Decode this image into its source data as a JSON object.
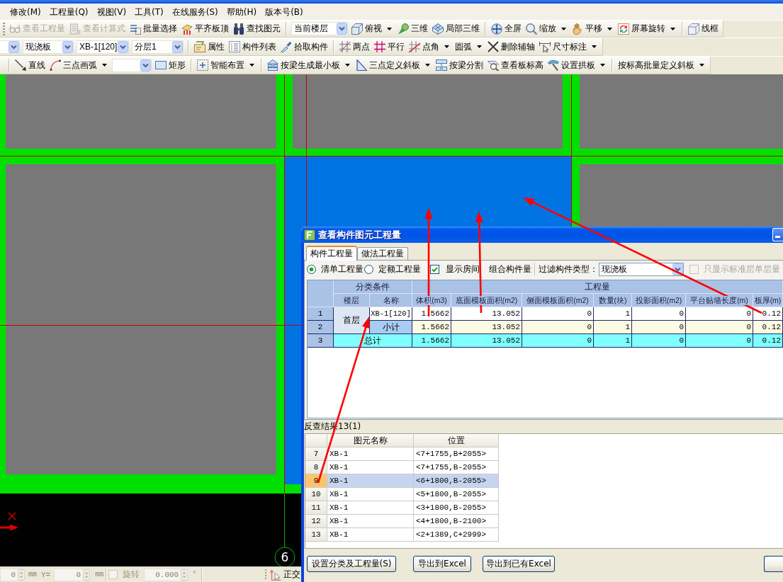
{
  "menu": [
    "修改(M)",
    "工程量(Q)",
    "视图(V)",
    "工具(T)",
    "在线服务(S)",
    "帮助(H)",
    "版本号(B)"
  ],
  "toolbars": [
    [
      [
        {
          "kind": "button",
          "label": "查看工程量",
          "dropdown": false,
          "disabled": true
        },
        {
          "kind": "button",
          "label": "查看计算式",
          "dropdown": false,
          "disabled": true
        },
        {
          "kind": "button",
          "label": "批量选择",
          "dropdown": false,
          "disabled": false
        },
        {
          "kind": "button",
          "label": "平齐板顶",
          "dropdown": false,
          "disabled": false
        },
        {
          "kind": "button",
          "label": "查找图元",
          "dropdown": false,
          "disabled": false
        }
      ],
      [
        {
          "kind": "combo",
          "value": "当前楼层"
        },
        {
          "kind": "button",
          "label": "俯视",
          "dropdown": true,
          "disabled": false
        },
        {
          "kind": "button",
          "label": "三维",
          "dropdown": false,
          "disabled": false
        },
        {
          "kind": "button",
          "label": "局部三维",
          "dropdown": false,
          "disabled": false
        }
      ],
      [
        {
          "kind": "button",
          "label": "全屏",
          "dropdown": false,
          "disabled": false
        },
        {
          "kind": "button",
          "label": "缩放",
          "dropdown": true,
          "disabled": false
        },
        {
          "kind": "button",
          "label": "平移",
          "dropdown": true,
          "disabled": false
        },
        {
          "kind": "button",
          "label": "屏幕旋转",
          "dropdown": true,
          "disabled": false
        }
      ],
      [
        {
          "kind": "button",
          "label": "线框",
          "dropdown": false,
          "disabled": false
        }
      ]
    ],
    [
      [
        {
          "kind": "combo"
        },
        {
          "kind": "combo",
          "value": "现浇板"
        },
        {
          "kind": "combo",
          "value": "XB-1[120]"
        },
        {
          "kind": "combo",
          "value": "分层1"
        }
      ],
      [
        {
          "kind": "button",
          "label": "属性",
          "dropdown": false,
          "disabled": false
        },
        {
          "kind": "button",
          "label": "构件列表",
          "dropdown": false,
          "disabled": false
        },
        {
          "kind": "button",
          "label": "拾取构件",
          "dropdown": false,
          "disabled": false
        }
      ],
      [
        {
          "kind": "button",
          "label": "两点",
          "dropdown": false,
          "disabled": false
        },
        {
          "kind": "button",
          "label": "平行",
          "dropdown": false,
          "disabled": false
        },
        {
          "kind": "button",
          "label": "点角",
          "dropdown": true,
          "disabled": false
        },
        {
          "kind": "button",
          "label": "圆弧",
          "dropdown": true,
          "disabled": false
        },
        {
          "kind": "button",
          "label": "删除辅轴",
          "dropdown": false,
          "disabled": false
        },
        {
          "kind": "button",
          "label": "尺寸标注",
          "dropdown": true,
          "disabled": false
        }
      ]
    ],
    [
      [
        {
          "kind": "button",
          "label": "直线",
          "dropdown": false,
          "disabled": false
        },
        {
          "kind": "button",
          "label": "三点画弧",
          "dropdown": true,
          "disabled": false
        },
        {
          "kind": "combo"
        },
        {
          "kind": "button",
          "label": "矩形",
          "dropdown": false,
          "disabled": false
        }
      ],
      [
        {
          "kind": "button",
          "label": "智能布置",
          "dropdown": true,
          "disabled": false
        }
      ],
      [
        {
          "kind": "button",
          "label": "按梁生成最小板",
          "dropdown": true,
          "disabled": false
        },
        {
          "kind": "button",
          "label": "三点定义斜板",
          "dropdown": true,
          "disabled": false
        },
        {
          "kind": "button",
          "label": "按梁分割",
          "dropdown": false,
          "disabled": false
        },
        {
          "kind": "button",
          "label": "查看板标高",
          "dropdown": false,
          "disabled": false
        },
        {
          "kind": "button",
          "label": "设置拱板",
          "dropdown": true,
          "disabled": false
        }
      ],
      [
        {
          "kind": "button",
          "label": "按标高批量定义斜板",
          "dropdown": true,
          "disabled": false
        }
      ]
    ]
  ],
  "canvas": {
    "slabs": [
      {
        "selected": false
      },
      {
        "selected": false
      },
      {
        "selected": false
      },
      {
        "selected": false
      },
      {
        "selected": true
      },
      {
        "selected": false
      }
    ],
    "axis_labels": [
      "6"
    ]
  },
  "status_bar": {
    "x_field": {
      "value": "0",
      "disabled": true
    },
    "x_unit": "mm",
    "y_label": "Y=",
    "y_field": {
      "value": "0",
      "disabled": true
    },
    "y_unit": "mm",
    "rotate_checkbox": {
      "label": "旋转",
      "checked": false,
      "disabled": true
    },
    "angle_field": {
      "value": "0.000",
      "disabled": true
    },
    "angle_unit": "°",
    "ortho_button": {
      "label": "正交"
    }
  },
  "dialog": {
    "title": "查看构件图元工程量",
    "tabs": [
      {
        "label": "构件工程量",
        "selected": true
      },
      {
        "label": "做法工程量",
        "selected": false
      }
    ],
    "quantity_modes": [
      {
        "label": "清单工程量",
        "selected": true
      },
      {
        "label": "定额工程量",
        "selected": false
      }
    ],
    "show_rooms": {
      "label": "显示房间",
      "checked": true
    },
    "combined_label": "组合构件量",
    "filter": {
      "label": "过滤构件类型：",
      "value": "现浇板"
    },
    "standard_floor_only": {
      "label": "只显示标准层单层量",
      "checked": false,
      "disabled": true
    },
    "quantity_table": {
      "group_headers": [
        "分类条件",
        "工程量"
      ],
      "columns": [
        "楼层",
        "名称",
        "体积(m3)",
        "底面模板面积(m2)",
        "侧面模板面积(m2)",
        "数量(块)",
        "投影面积(m2)",
        "平台贴墙长度(m)",
        "板厚(m)"
      ],
      "rows": [
        {
          "kind": "item",
          "index": "1",
          "floor": "首层",
          "name": "XB-1[120]",
          "values": [
            "1.5662",
            "13.052",
            "0",
            "1",
            "0",
            "0",
            "0.12"
          ]
        },
        {
          "kind": "subtotal",
          "index": "2",
          "name": "小计",
          "values": [
            "1.5662",
            "13.052",
            "0",
            "1",
            "0",
            "0",
            "0.12"
          ]
        },
        {
          "kind": "total",
          "index": "3",
          "name": "总计",
          "values": [
            "1.5662",
            "13.052",
            "0",
            "1",
            "0",
            "0",
            "0.12"
          ]
        }
      ]
    },
    "results_label": "反查结果13(1)",
    "results_table": {
      "columns": [
        "图元名称",
        "位置"
      ],
      "rows": [
        {
          "index": "7",
          "name": "XB-1",
          "position": "<7+1755,B+2055>",
          "selected": false
        },
        {
          "index": "8",
          "name": "XB-1",
          "position": "<7+1755,B-2055>",
          "selected": false
        },
        {
          "index": "9",
          "name": "XB-1",
          "position": "<6+1800,B-2055>",
          "selected": true
        },
        {
          "index": "10",
          "name": "XB-1",
          "position": "<5+1800,B-2055>",
          "selected": false
        },
        {
          "index": "11",
          "name": "XB-1",
          "position": "<3+1800,B-2055>",
          "selected": false
        },
        {
          "index": "12",
          "name": "XB-1",
          "position": "<4+1800,B-2100>",
          "selected": false
        },
        {
          "index": "13",
          "name": "XB-1",
          "position": "<2+1389,C+2999>",
          "selected": false
        }
      ]
    },
    "buttons": [
      "设置分类及工程量(S)",
      "导出到Excel",
      "导出到已有Excel"
    ]
  }
}
